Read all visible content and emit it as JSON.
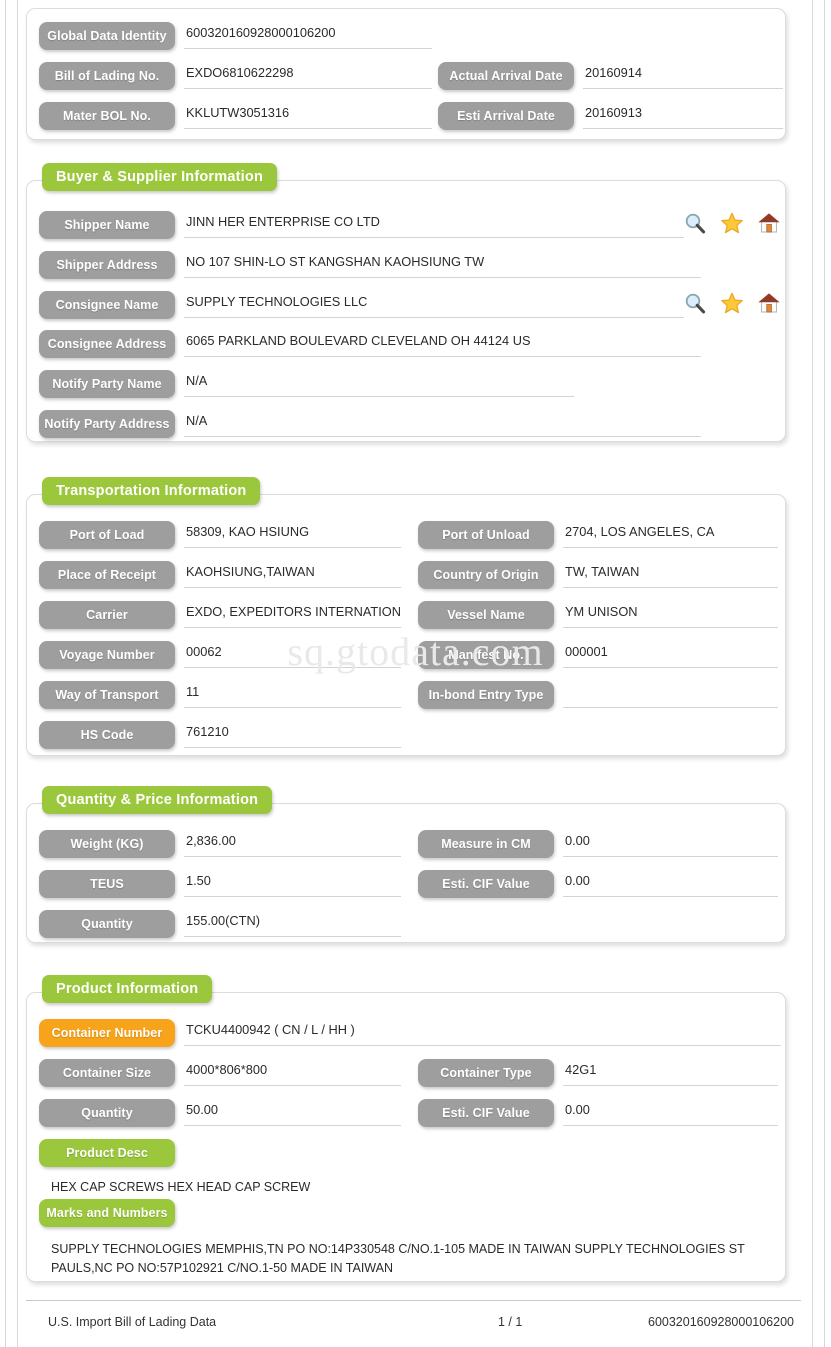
{
  "watermark": "sq.gtodata.com",
  "header_card": {
    "rows": [
      {
        "label": "Global Data Identity",
        "value": "600320160928000106200"
      },
      {
        "label": "Bill of Lading No.",
        "value": "EXDO6810622298"
      },
      {
        "label": "Mater BOL No.",
        "value": "KKLUTW3051316"
      }
    ],
    "rows_right": [
      {
        "label": "Actual Arrival Date",
        "value": "20160914"
      },
      {
        "label": "Esti Arrival Date",
        "value": "20160913"
      }
    ]
  },
  "buyer_supplier": {
    "title": "Buyer & Supplier Information",
    "rows": [
      {
        "label": "Shipper Name",
        "value": "JINN HER ENTERPRISE CO LTD"
      },
      {
        "label": "Shipper Address",
        "value": "NO 107 SHIN-LO ST KANGSHAN KAOHSIUNG TW"
      },
      {
        "label": "Consignee Name",
        "value": "SUPPLY TECHNOLOGIES LLC"
      },
      {
        "label": "Consignee Address",
        "value": "6065 PARKLAND BOULEVARD CLEVELAND OH 44124 US"
      },
      {
        "label": "Notify Party Name",
        "value": "N/A"
      },
      {
        "label": "Notify Party Address",
        "value": "N/A"
      }
    ],
    "icons": [
      "search-icon",
      "star-icon",
      "home-icon"
    ]
  },
  "transportation": {
    "title": "Transportation Information",
    "rows_left": [
      {
        "label": "Port of Load",
        "value": "58309, KAO HSIUNG"
      },
      {
        "label": "Place of Receipt",
        "value": "KAOHSIUNG,TAIWAN"
      },
      {
        "label": "Carrier",
        "value": "EXDO, EXPEDITORS INTERNATIONAL"
      },
      {
        "label": "Voyage Number",
        "value": "00062"
      },
      {
        "label": "Way of Transport",
        "value": "11"
      },
      {
        "label": "HS Code",
        "value": "761210"
      }
    ],
    "rows_right": [
      {
        "label": "Port of Unload",
        "value": "2704, LOS ANGELES, CA"
      },
      {
        "label": "Country of Origin",
        "value": "TW, TAIWAN"
      },
      {
        "label": "Vessel Name",
        "value": "YM UNISON"
      },
      {
        "label": "Manifest No.",
        "value": "000001"
      },
      {
        "label": "In-bond Entry Type",
        "value": ""
      }
    ]
  },
  "quantity_price": {
    "title": "Quantity & Price Information",
    "rows_left": [
      {
        "label": "Weight (KG)",
        "value": "2,836.00"
      },
      {
        "label": "TEUS",
        "value": "1.50"
      },
      {
        "label": "Quantity",
        "value": "155.00(CTN)"
      }
    ],
    "rows_right": [
      {
        "label": "Measure in CM",
        "value": "0.00"
      },
      {
        "label": "Esti. CIF Value",
        "value": "0.00"
      }
    ]
  },
  "product": {
    "title": "Product Information",
    "container_number": {
      "label": "Container Number",
      "value": "TCKU4400942 ( CN / L / HH )"
    },
    "rows_left": [
      {
        "label": "Container Size",
        "value": "4000*806*800"
      },
      {
        "label": "Quantity",
        "value": "50.00"
      }
    ],
    "rows_right": [
      {
        "label": "Container Type",
        "value": "42G1"
      },
      {
        "label": "Esti. CIF Value",
        "value": "0.00"
      }
    ],
    "product_desc": {
      "label": "Product Desc",
      "text": "HEX CAP SCREWS HEX HEAD CAP SCREW"
    },
    "marks_numbers": {
      "label": "Marks and Numbers",
      "text": "SUPPLY TECHNOLOGIES MEMPHIS,TN PO NO:14P330548 C/NO.1-105 MADE IN TAIWAN SUPPLY TECHNOLOGIES ST PAULS,NC PO NO:57P102921 C/NO.1-50 MADE IN TAIWAN"
    }
  },
  "footer": {
    "left": "U.S. Import Bill of Lading Data",
    "page": "1 / 1",
    "right": "600320160928000106200"
  },
  "colors": {
    "green": "#9ac73b",
    "orange": "#f8a41b",
    "gray_pill": "#9e9e9e",
    "underline": "#d3d3d3"
  }
}
